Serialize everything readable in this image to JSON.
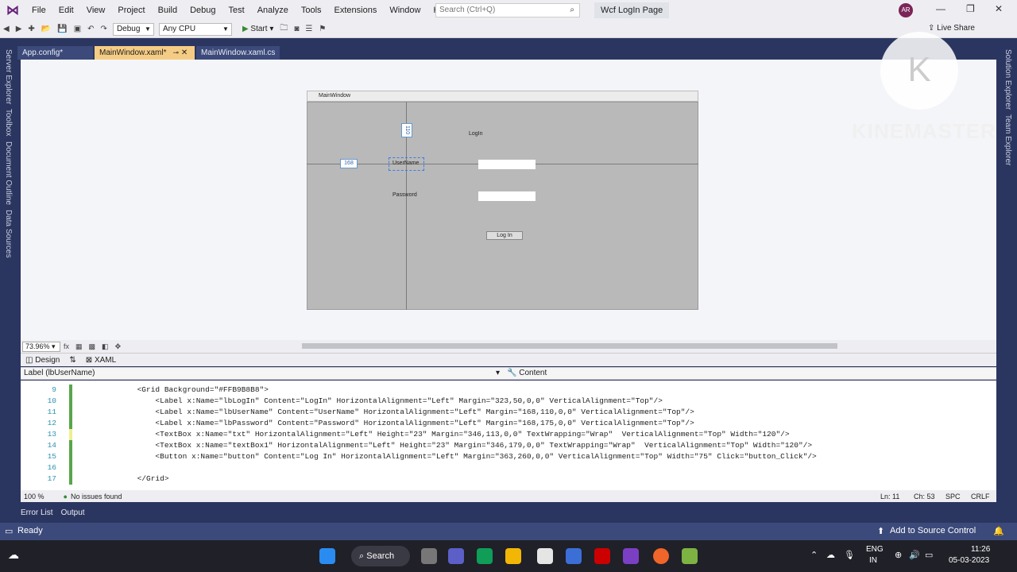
{
  "menubar": {
    "items": [
      "File",
      "Edit",
      "View",
      "Project",
      "Build",
      "Debug",
      "Test",
      "Analyze",
      "Tools",
      "Extensions",
      "Window",
      "Help"
    ],
    "search_placeholder": "Search (Ctrl+Q)",
    "solution_title": "Wcf LogIn Page",
    "avatar": "AR"
  },
  "toolbar": {
    "config": "Debug",
    "platform": "Any CPU",
    "start": "Start",
    "live_share": "Live Share"
  },
  "left_rail": [
    "Server Explorer",
    "Toolbox",
    "Document Outline",
    "Data Sources"
  ],
  "right_rail": [
    "Solution Explorer",
    "Team Explorer"
  ],
  "tabs": [
    {
      "label": "App.config*"
    },
    {
      "label": "MainWindow.xaml*"
    },
    {
      "label": "MainWindow.xaml.cs"
    }
  ],
  "designer": {
    "window_title": "MainWindow",
    "login_label": "LogIn",
    "username_label": "UserName",
    "password_label": "Password",
    "button_label": "Log In",
    "margin_top": "110",
    "margin_left": "168"
  },
  "watermark": "KINEMASTER",
  "zoom": "73.96%",
  "view_tabs": {
    "design": "Design",
    "swap": "⇅",
    "xaml": "XAML"
  },
  "navbar": {
    "left": "Label (lbUserName)",
    "right": "Content"
  },
  "code": [
    {
      "n": "9",
      "t": "        <Grid Background=\"#FFB9B8B8\">"
    },
    {
      "n": "10",
      "t": "            <Label x:Name=\"lbLogIn\" Content=\"LogIn\" HorizontalAlignment=\"Left\" Margin=\"323,50,0,0\" VerticalAlignment=\"Top\"/>"
    },
    {
      "n": "11",
      "t": "            <Label x:Name=\"lbUserName\" Content=\"UserName\" HorizontalAlignment=\"Left\" Margin=\"168,110,0,0\" VerticalAlignment=\"Top\"/>"
    },
    {
      "n": "12",
      "t": "            <Label x:Name=\"lbPassword\" Content=\"Password\" HorizontalAlignment=\"Left\" Margin=\"168,175,0,0\" VerticalAlignment=\"Top\"/>"
    },
    {
      "n": "13",
      "t": "            <TextBox x:Name=\"txt\" HorizontalAlignment=\"Left\" Height=\"23\" Margin=\"346,113,0,0\" TextWrapping=\"Wrap\"  VerticalAlignment=\"Top\" Width=\"120\"/>"
    },
    {
      "n": "14",
      "t": "            <TextBox x:Name=\"textBox1\" HorizontalAlignment=\"Left\" Height=\"23\" Margin=\"346,179,0,0\" TextWrapping=\"Wrap\"  VerticalAlignment=\"Top\" Width=\"120\"/>"
    },
    {
      "n": "15",
      "t": "            <Button x:Name=\"button\" Content=\"Log In\" HorizontalAlignment=\"Left\" Margin=\"363,260,0,0\" VerticalAlignment=\"Top\" Width=\"75\" Click=\"button_Click\"/>"
    },
    {
      "n": "16",
      "t": ""
    },
    {
      "n": "17",
      "t": "        </Grid>"
    }
  ],
  "editor_status": {
    "zoom": "100 %",
    "issues": "No issues found",
    "line": "Ln: 11",
    "col": "Ch: 53",
    "spc": "SPC",
    "crlf": "CRLF"
  },
  "output_tabs": [
    "Error List",
    "Output"
  ],
  "status": {
    "ready": "Ready",
    "source": "Add to Source Control"
  },
  "taskbar": {
    "search": "Search",
    "lang1": "ENG",
    "lang2": "IN",
    "time": "11:26",
    "date": "05-03-2023"
  }
}
